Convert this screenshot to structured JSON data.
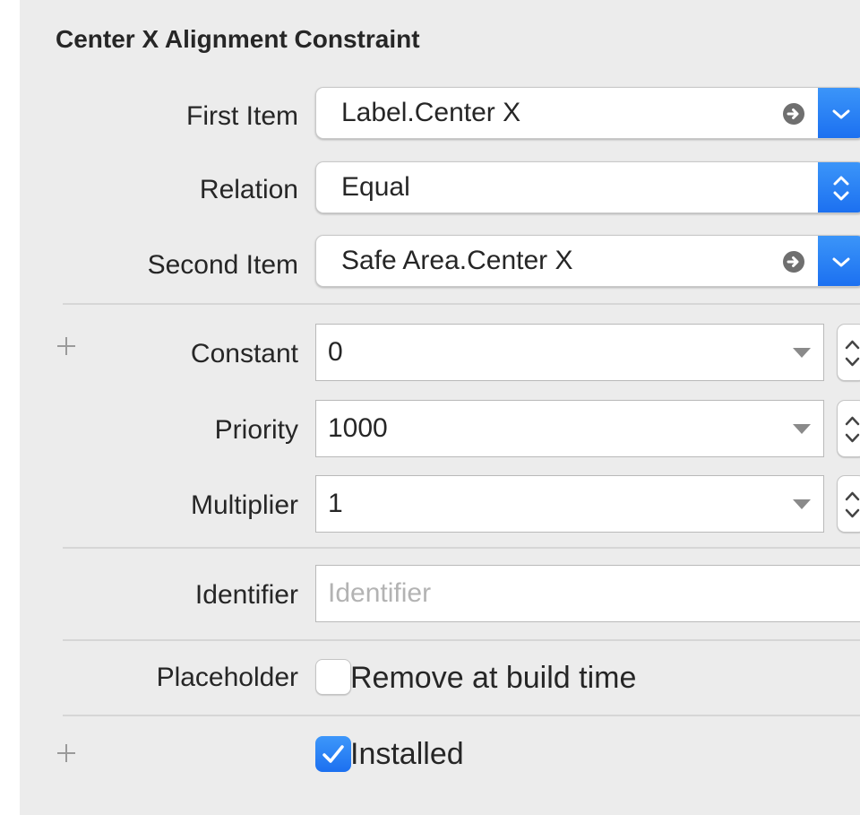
{
  "title": "Center X Alignment Constraint",
  "first_item": {
    "label": "First Item",
    "value": "Label.Center X"
  },
  "relation": {
    "label": "Relation",
    "value": "Equal"
  },
  "second_item": {
    "label": "Second Item",
    "value": "Safe Area.Center X"
  },
  "constant": {
    "label": "Constant",
    "value": "0"
  },
  "priority": {
    "label": "Priority",
    "value": "1000"
  },
  "multiplier": {
    "label": "Multiplier",
    "value": "1"
  },
  "identifier": {
    "label": "Identifier",
    "value": "",
    "placeholder": "Identifier"
  },
  "placeholder_row": {
    "label": "Placeholder",
    "checkbox_label": "Remove at build time",
    "checked": false
  },
  "installed": {
    "checkbox_label": "Installed",
    "checked": true
  },
  "icons": {
    "add": "plus-icon",
    "goto": "arrow-circle-right-icon",
    "dropdown": "chevron-down-icon",
    "popup": "chevron-up-down-icon",
    "combo": "triangle-down-icon",
    "stepper": "stepper-icon",
    "check": "checkmark-icon"
  },
  "colors": {
    "accent": "#1b6ff0",
    "panel_bg": "#ececec",
    "placeholder_text": "#b3b3b3"
  }
}
